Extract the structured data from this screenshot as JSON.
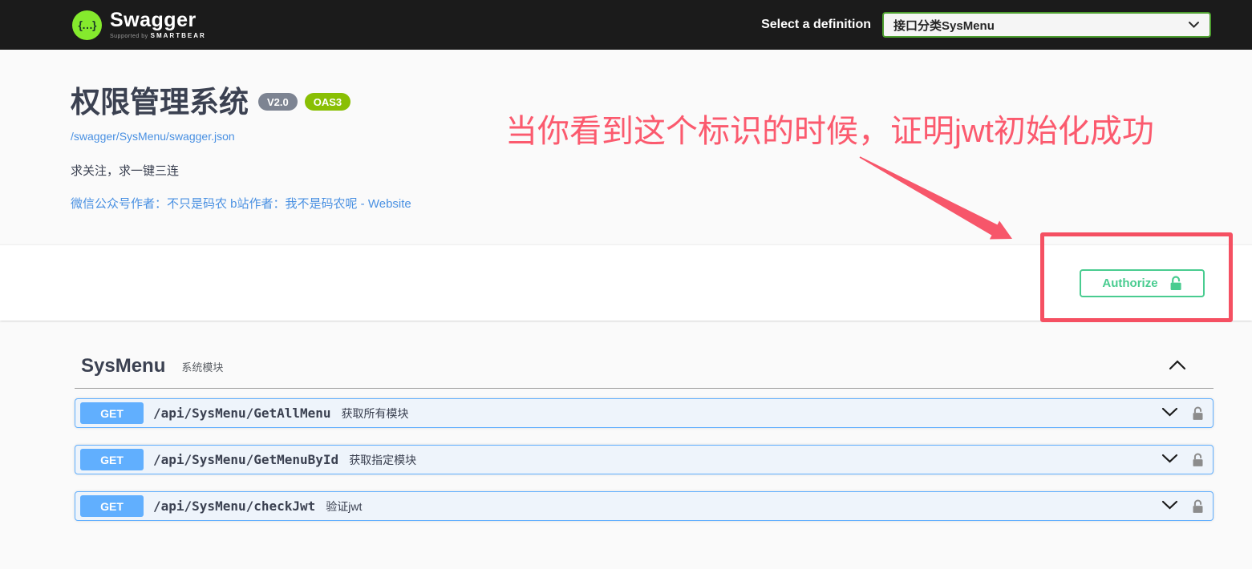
{
  "topbar": {
    "logo_glyph": "{…}",
    "logo_text": "Swagger",
    "logo_subtext_prefix": "Supported by",
    "logo_subtext_brand": "SMARTBEAR",
    "select_label": "Select a definition",
    "select_value": "接口分类SysMenu"
  },
  "info": {
    "title": "权限管理系统",
    "version_badge": "V2.0",
    "oas_badge": "OAS3",
    "spec_link": "/swagger/SysMenu/swagger.json",
    "description": "求关注，求一键三连",
    "contact_line": "微信公众号作者：不只是码农 b站作者：我不是码农呢 - Website"
  },
  "annotation": {
    "text": "当你看到这个标识的时候，证明jwt初始化成功",
    "text_color": "#fb5a6e",
    "box_color": "#f55062"
  },
  "auth": {
    "authorize_label": "Authorize"
  },
  "section": {
    "name": "SysMenu",
    "description": "系统模块"
  },
  "operations": [
    {
      "method": "GET",
      "path": "/api/SysMenu/GetAllMenu",
      "summary": "获取所有模块"
    },
    {
      "method": "GET",
      "path": "/api/SysMenu/GetMenuById",
      "summary": "获取指定模块"
    },
    {
      "method": "GET",
      "path": "/api/SysMenu/checkJwt",
      "summary": "验证jwt"
    }
  ],
  "colors": {
    "get_blue": "#61affe",
    "auth_green": "#49cc90",
    "oas_green": "#89bf04",
    "version_gray": "#7d8492",
    "topbar_black": "#1b1b1b",
    "link_blue": "#4990e2"
  }
}
